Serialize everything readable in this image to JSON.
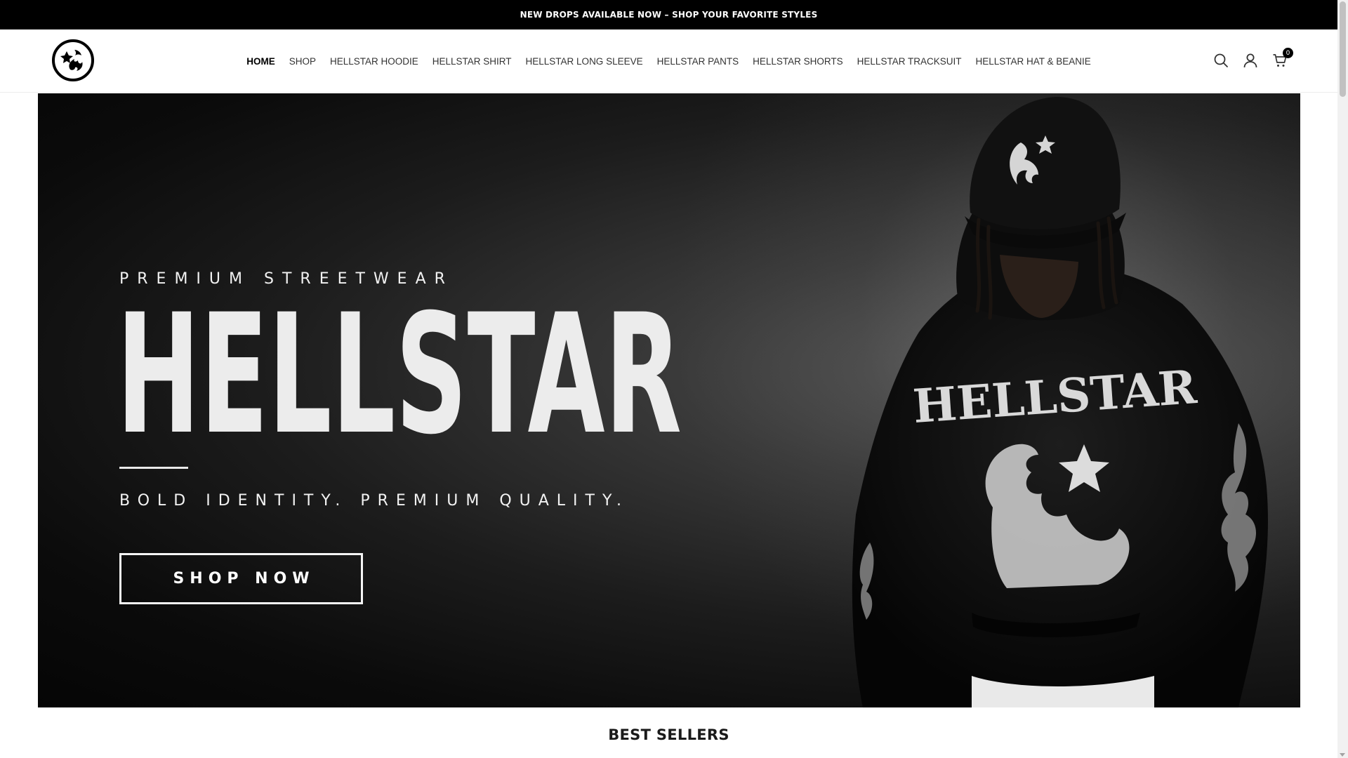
{
  "announcement": {
    "text": "NEW DROPS AVAILABLE NOW – SHOP YOUR FAVORITE STYLES"
  },
  "header": {
    "logo_icon": "hellstar-logo-icon",
    "nav": [
      {
        "label": "HOME",
        "active": true
      },
      {
        "label": "SHOP"
      },
      {
        "label": "HELLSTAR HOODIE"
      },
      {
        "label": "HELLSTAR SHIRT"
      },
      {
        "label": "HELLSTAR LONG SLEEVE"
      },
      {
        "label": "HELLSTAR PANTS"
      },
      {
        "label": "HELLSTAR SHORTS"
      },
      {
        "label": "HELLSTAR TRACKSUIT"
      },
      {
        "label": "HELLSTAR HAT & BEANIE"
      }
    ],
    "icons": [
      "search-icon",
      "account-icon",
      "cart-icon"
    ],
    "cart_count": "0"
  },
  "hero": {
    "tagline_top": "PREMIUM STREETWEAR",
    "title": "HELLSTAR",
    "tagline_bottom": "BOLD IDENTITY. PREMIUM QUALITY.",
    "cta_label": "SHOP NOW",
    "hoodie_print": "HELLSTAR"
  },
  "sections": {
    "best_sellers_title": "BEST SELLERS"
  },
  "colors": {
    "announcement_bg": "#000000",
    "hero_bg": "#0b0b0b",
    "text_light": "#f2f2f2",
    "accent": "#000000"
  }
}
